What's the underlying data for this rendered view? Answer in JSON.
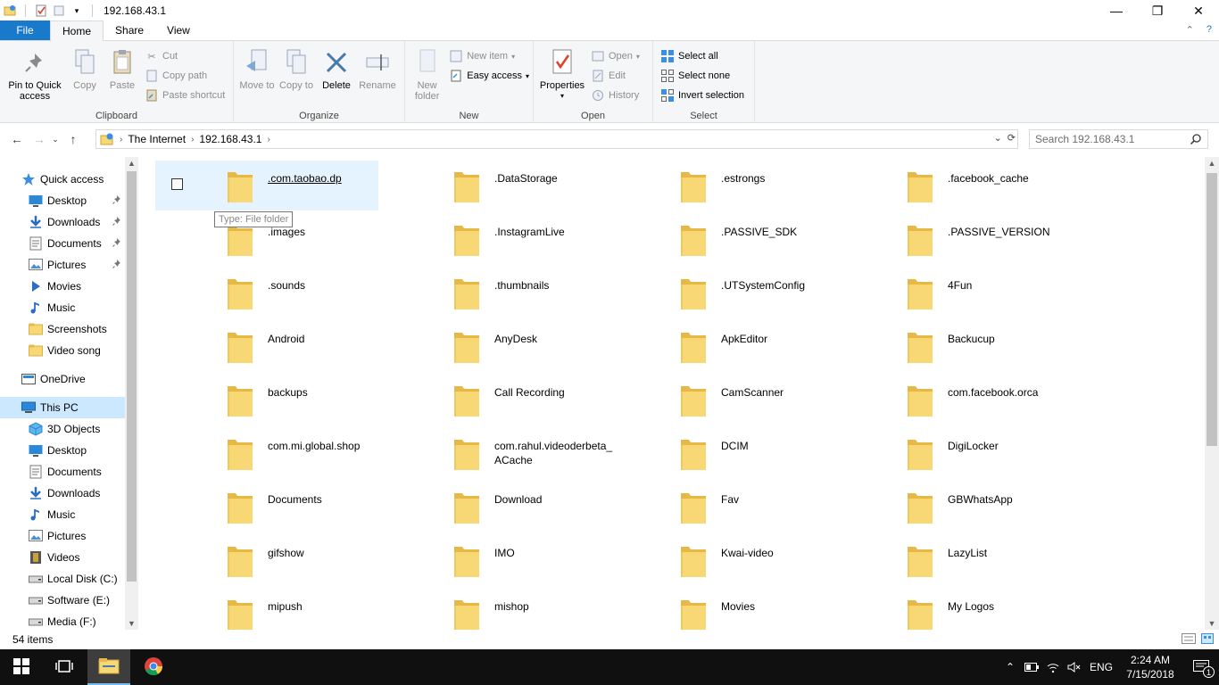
{
  "window": {
    "title": "192.168.43.1",
    "minimize": "—",
    "restore": "❐",
    "close": "✕"
  },
  "tabs": {
    "file": "File",
    "home": "Home",
    "share": "Share",
    "view": "View",
    "collapse": "⌃",
    "help": "?"
  },
  "ribbon": {
    "clipboard": {
      "label": "Clipboard",
      "pin": "Pin to Quick access",
      "copy": "Copy",
      "paste": "Paste",
      "cut": "Cut",
      "copy_path": "Copy path",
      "paste_shortcut": "Paste shortcut"
    },
    "organize": {
      "label": "Organize",
      "move_to": "Move to",
      "copy_to": "Copy to",
      "delete": "Delete",
      "rename": "Rename"
    },
    "new": {
      "label": "New",
      "new_folder": "New folder",
      "new_item": "New item",
      "easy_access": "Easy access"
    },
    "open": {
      "label": "Open",
      "properties": "Properties",
      "open": "Open",
      "edit": "Edit",
      "history": "History"
    },
    "select": {
      "label": "Select",
      "select_all": "Select all",
      "select_none": "Select none",
      "invert": "Invert selection"
    }
  },
  "address": {
    "segments": [
      "The Internet",
      "192.168.43.1"
    ],
    "search_placeholder": "Search 192.168.43.1"
  },
  "nav": {
    "quick_access": "Quick access",
    "quick_items": [
      {
        "label": "Desktop",
        "icon": "desktop-icon",
        "pinned": true
      },
      {
        "label": "Downloads",
        "icon": "download-arrow-icon",
        "pinned": true
      },
      {
        "label": "Documents",
        "icon": "document-icon",
        "pinned": true
      },
      {
        "label": "Pictures",
        "icon": "picture-icon",
        "pinned": true
      },
      {
        "label": "Movies",
        "icon": "play-icon",
        "pinned": false
      },
      {
        "label": "Music",
        "icon": "music-note-icon",
        "pinned": false
      },
      {
        "label": "Screenshots",
        "icon": "folder-icon",
        "pinned": false
      },
      {
        "label": "Video song",
        "icon": "folder-icon",
        "pinned": false
      }
    ],
    "onedrive": "OneDrive",
    "this_pc": "This PC",
    "pc_items": [
      {
        "label": "3D Objects",
        "icon": "cube-icon"
      },
      {
        "label": "Desktop",
        "icon": "desktop-icon"
      },
      {
        "label": "Documents",
        "icon": "document-icon"
      },
      {
        "label": "Downloads",
        "icon": "download-arrow-icon"
      },
      {
        "label": "Music",
        "icon": "music-note-icon"
      },
      {
        "label": "Pictures",
        "icon": "picture-icon"
      },
      {
        "label": "Videos",
        "icon": "film-icon"
      },
      {
        "label": "Local Disk (C:)",
        "icon": "drive-icon"
      },
      {
        "label": "Software (E:)",
        "icon": "drive-icon"
      },
      {
        "label": "Media (F:)",
        "icon": "drive-icon"
      }
    ]
  },
  "folders": [
    [
      ".com.taobao.dp",
      ".DataStorage",
      ".estrongs",
      ".facebook_cache"
    ],
    [
      ".images",
      ".InstagramLive",
      ".PASSIVE_SDK",
      ".PASSIVE_VERSION"
    ],
    [
      ".sounds",
      ".thumbnails",
      ".UTSystemConfig",
      "4Fun"
    ],
    [
      "Android",
      "AnyDesk",
      "ApkEditor",
      "Backucup"
    ],
    [
      "backups",
      "Call Recording",
      "CamScanner",
      "com.facebook.orca"
    ],
    [
      "com.mi.global.shop",
      "com.rahul.videoderbeta_ ACache",
      "DCIM",
      "DigiLocker"
    ],
    [
      "Documents",
      "Download",
      "Fav",
      "GBWhatsApp"
    ],
    [
      "gifshow",
      "IMO",
      "Kwai-video",
      "LazyList"
    ],
    [
      "mipush",
      "mishop",
      "Movies",
      "My Logos"
    ]
  ],
  "tooltip": "Type: File folder",
  "status": {
    "item_count": "54 items"
  },
  "taskbar": {
    "lang": "ENG",
    "time": "2:24 AM",
    "date": "7/15/2018",
    "notif_count": "1"
  },
  "colors": {
    "accent": "#1979ca",
    "folder": "#f8d775",
    "selection": "#cce8ff"
  }
}
